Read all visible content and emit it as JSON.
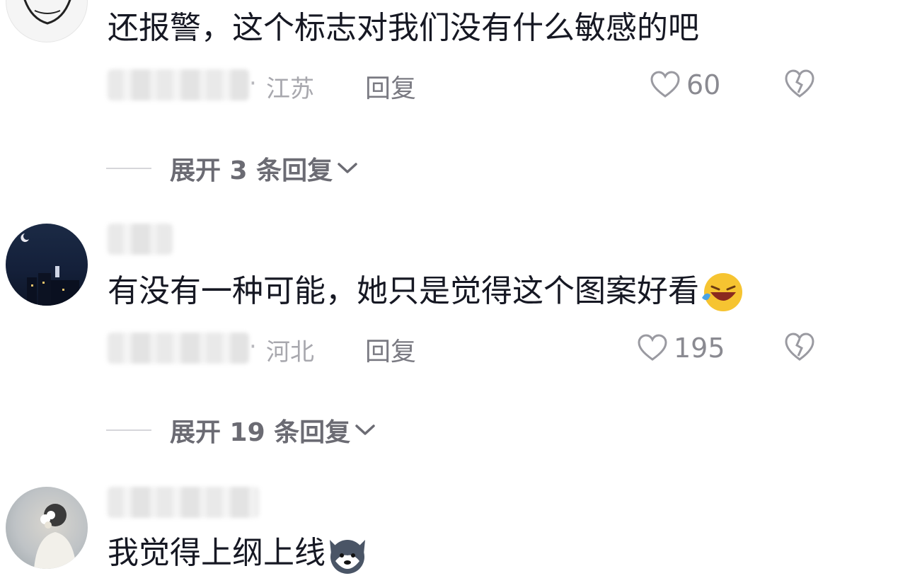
{
  "comments": [
    {
      "text": "还报警，这个标志对我们没有什么敏感的吧",
      "location": "江苏",
      "reply_label": "回复",
      "likes": "60",
      "expand_label": "展开 3 条回复"
    },
    {
      "text": "有没有一种可能，她只是觉得这个图案好看",
      "location": "河北",
      "reply_label": "回复",
      "likes": "195",
      "expand_label": "展开 19 条回复"
    },
    {
      "text": "我觉得上纲上线"
    }
  ],
  "separator": "·",
  "colors": {
    "text": "#161823",
    "meta": "#a8a8ae",
    "secondary": "#7a7a82"
  }
}
